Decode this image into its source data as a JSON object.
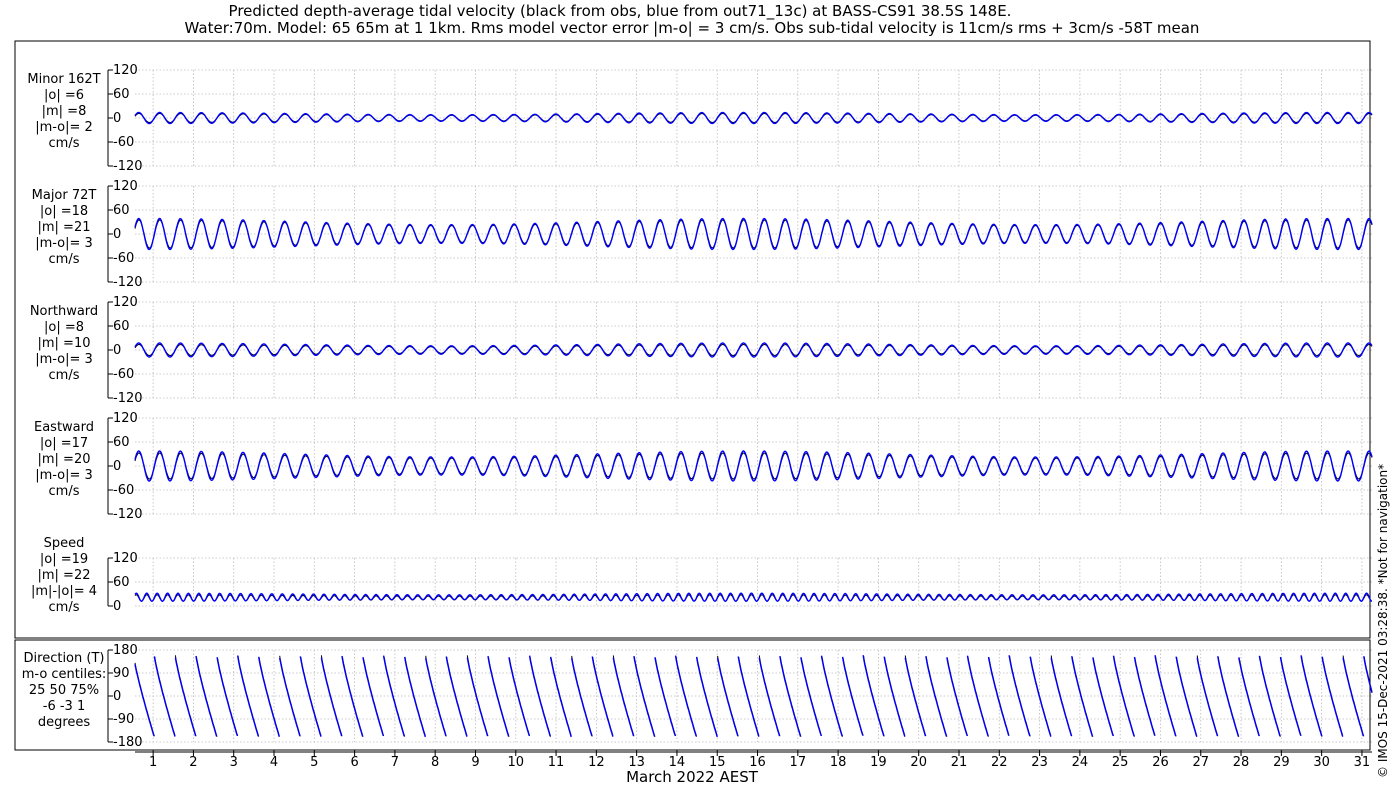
{
  "figure": {
    "title_line1": "Predicted depth-average tidal velocity (black from obs, blue from out71_13c) at BASS-CS91 38.5S 148E.",
    "title_line2": "Water:70m. Model: 65 65m at 1 1km. Rms model vector error |m-o| = 3 cm/s. Obs sub-tidal velocity is 11cm/s rms + 3cm/s -58T mean",
    "xlabel": "March 2022 AEST",
    "side_note": "© IMOS 15-Dec-2021 03:28:38. *Not for navigation*",
    "colors": {
      "obs": "#000000",
      "model": "#0000ff",
      "grid": "#bbbbbb"
    }
  },
  "chart_data": [
    {
      "type": "line",
      "panel": "minor",
      "label": [
        "Minor 162T",
        "|o| =6",
        "|m| =8",
        "|m-o|= 2",
        "cm/s"
      ],
      "ylim": [
        -120,
        120
      ],
      "yticks": [
        "120",
        "60",
        "0",
        "-60",
        "-120"
      ],
      "ytick_values": [
        120,
        60,
        0,
        -60,
        -120
      ],
      "series": [
        {
          "color": "#000000",
          "amplitude": 9,
          "mean": 0
        },
        {
          "color": "#0000ff",
          "amplitude": 11,
          "mean": 0
        }
      ]
    },
    {
      "type": "line",
      "panel": "major",
      "label": [
        "Major 72T",
        "|o| =18",
        "|m| =21",
        "|m-o|= 3",
        "cm/s"
      ],
      "ylim": [
        -120,
        120
      ],
      "yticks": [
        "120",
        "60",
        "0",
        "-60",
        "-120"
      ],
      "ytick_values": [
        120,
        60,
        0,
        -60,
        -120
      ],
      "series": [
        {
          "color": "#000000",
          "amplitude": 28,
          "mean": 0
        },
        {
          "color": "#0000ff",
          "amplitude": 31,
          "mean": 0
        }
      ]
    },
    {
      "type": "line",
      "panel": "northward",
      "label": [
        "Northward",
        "|o| =8",
        "|m| =10",
        "|m-o|= 3",
        "cm/s"
      ],
      "ylim": [
        -120,
        120
      ],
      "yticks": [
        "120",
        "60",
        "0",
        "-60",
        "-120"
      ],
      "ytick_values": [
        120,
        60,
        0,
        -60,
        -120
      ],
      "series": [
        {
          "color": "#000000",
          "amplitude": 11,
          "mean": 0
        },
        {
          "color": "#0000ff",
          "amplitude": 14,
          "mean": 0
        }
      ]
    },
    {
      "type": "line",
      "panel": "eastward",
      "label": [
        "Eastward",
        "|o| =17",
        "|m| =20",
        "|m-o|= 3",
        "cm/s"
      ],
      "ylim": [
        -120,
        120
      ],
      "yticks": [
        "120",
        "60",
        "0",
        "-60",
        "-120"
      ],
      "ytick_values": [
        120,
        60,
        0,
        -60,
        -120
      ],
      "series": [
        {
          "color": "#000000",
          "amplitude": 26,
          "mean": 0
        },
        {
          "color": "#0000ff",
          "amplitude": 30,
          "mean": 0
        }
      ]
    },
    {
      "type": "line",
      "panel": "speed",
      "label": [
        "Speed",
        "|o| =19",
        "|m| =22",
        "|m|-|o|= 4",
        "cm/s"
      ],
      "ylim": [
        0,
        120
      ],
      "yticks": [
        "120",
        "60",
        "0"
      ],
      "ytick_values": [
        120,
        60,
        0
      ],
      "series": [
        {
          "color": "#000000",
          "amplitude": 8,
          "mean": 20
        },
        {
          "color": "#0000ff",
          "amplitude": 10,
          "mean": 22
        }
      ]
    },
    {
      "type": "line",
      "panel": "direction",
      "label": [
        "Direction (T)",
        "m-o centiles:",
        "25  50  75%",
        "-6  -3  1",
        "degrees"
      ],
      "ylim": [
        -180,
        180
      ],
      "yticks": [
        "180",
        "90",
        "0",
        "-90",
        "-180"
      ],
      "ytick_values": [
        180,
        90,
        0,
        -90,
        -180
      ],
      "series": [
        {
          "color": "#000000"
        },
        {
          "color": "#0000ff"
        }
      ]
    }
  ],
  "xaxis": {
    "days": [
      "1",
      "2",
      "3",
      "4",
      "5",
      "6",
      "7",
      "8",
      "9",
      "10",
      "11",
      "12",
      "13",
      "14",
      "15",
      "16",
      "17",
      "18",
      "19",
      "20",
      "21",
      "22",
      "23",
      "24",
      "25",
      "26",
      "27",
      "28",
      "29",
      "30",
      "31"
    ],
    "range_days": [
      0.55,
      31.25
    ]
  }
}
